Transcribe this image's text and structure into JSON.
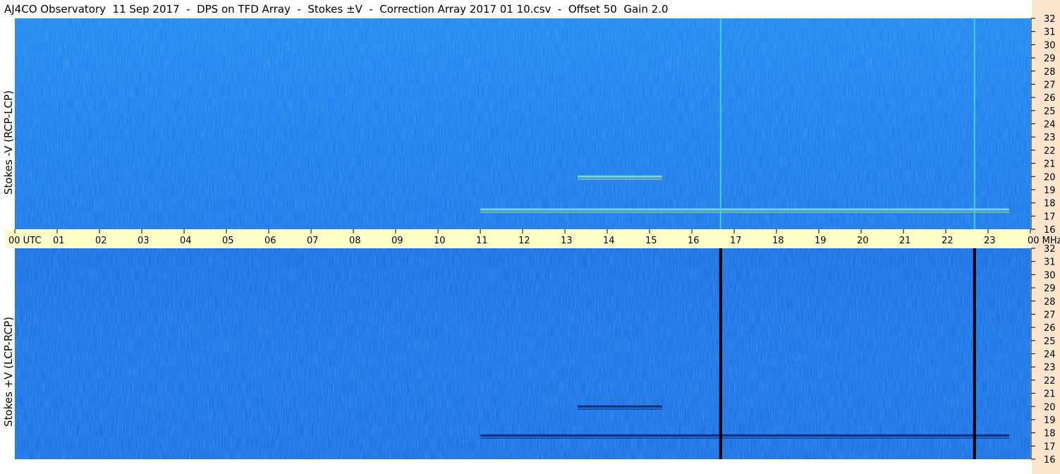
{
  "header": {
    "title": "AJ4CO Observatory  11 Sep 2017  -  DPS on TFD Array  -  Stokes ±V  -  Correction Array 2017 01 10.csv  -  Offset 50  Gain 2.0"
  },
  "colors": {
    "upper_background": "#1e82ee",
    "lower_background": "#1a6fe6",
    "time_axis_band": "#ffffc8",
    "freq_axis_strip": "#fbe3cc"
  },
  "chart_data": [
    {
      "type": "heatmap",
      "ylabel": "Stokes -V (RCP-LCP)",
      "x_unit": "UTC",
      "y_unit": "MHz",
      "xlim": [
        "00",
        "00"
      ],
      "ylim": [
        16,
        32
      ],
      "time_ticks": [
        "00",
        "01",
        "02",
        "03",
        "04",
        "05",
        "06",
        "07",
        "08",
        "09",
        "10",
        "11",
        "12",
        "13",
        "14",
        "15",
        "16",
        "17",
        "18",
        "19",
        "20",
        "21",
        "22",
        "23",
        "00"
      ],
      "freq_ticks": [
        32,
        31,
        30,
        29,
        28,
        27,
        26,
        25,
        24,
        23,
        22,
        21,
        20,
        19,
        18,
        17,
        16
      ],
      "vertical_lines_utc_hours": [
        16.68,
        22.68
      ],
      "burst_features": [
        {
          "start_hour": 11.0,
          "end_hour": 23.5,
          "freq_mhz": 17.5
        },
        {
          "start_hour": 13.3,
          "end_hour": 15.3,
          "freq_mhz": 20.0
        }
      ]
    },
    {
      "type": "heatmap",
      "ylabel": "Stokes +V (LCP-RCP)",
      "x_unit": "UTC",
      "y_unit": "MHz",
      "xlim": [
        "00",
        "00"
      ],
      "ylim": [
        16,
        32
      ],
      "time_ticks": [
        "00",
        "01",
        "02",
        "03",
        "04",
        "05",
        "06",
        "07",
        "08",
        "09",
        "10",
        "11",
        "12",
        "13",
        "14",
        "15",
        "16",
        "17",
        "18",
        "19",
        "20",
        "21",
        "22",
        "23",
        "00"
      ],
      "freq_ticks": [
        32,
        31,
        30,
        29,
        28,
        27,
        26,
        25,
        24,
        23,
        22,
        21,
        20,
        19,
        18,
        17,
        16
      ],
      "vertical_lines_utc_hours": [
        16.68,
        22.68
      ],
      "burst_features": [
        {
          "start_hour": 11.0,
          "end_hour": 23.5,
          "freq_mhz": 17.8
        },
        {
          "start_hour": 13.3,
          "end_hour": 15.3,
          "freq_mhz": 20.0
        }
      ]
    }
  ]
}
